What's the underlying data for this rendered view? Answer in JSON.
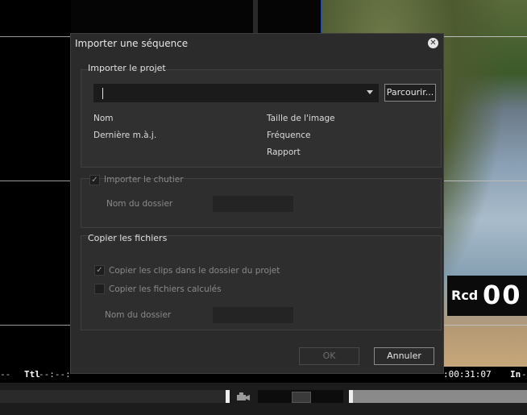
{
  "dialog": {
    "title": "Importer une séquence",
    "project_group": {
      "title": "Importer le projet",
      "combo_value": "",
      "browse_label": "Parcourir...",
      "info": {
        "name_label": "Nom",
        "last_update_label": "Dernière m.à.j.",
        "image_size_label": "Taille de l'image",
        "frequency_label": "Fréquence",
        "ratio_label": "Rapport"
      }
    },
    "bin_group": {
      "checkbox_label": "Importer le chutier",
      "checked": true,
      "folder_label": "Nom du dossier",
      "folder_value": ""
    },
    "copy_group": {
      "title": "Copier les fichiers",
      "copy_clips_label": "Copier les clips dans le dossier du projet",
      "copy_clips_checked": true,
      "copy_rendered_label": "Copier les fichiers calculés",
      "copy_rendered_checked": false,
      "folder_label": "Nom du dossier",
      "folder_value": ""
    },
    "ok_label": "OK",
    "cancel_label": "Annuler"
  },
  "background": {
    "rcd_label": "Rcd",
    "rcd_number": "00",
    "ttl_label": "Ttl",
    "ttl_value": "--:--:",
    "left_dashes": "--",
    "timecode": ":00:31:07",
    "in_label": "In",
    "in_value": "-"
  }
}
